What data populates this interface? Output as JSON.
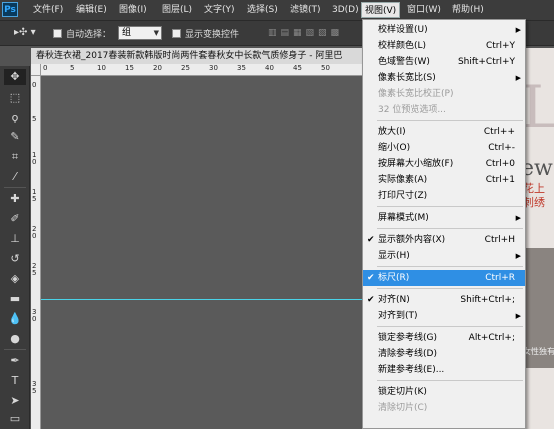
{
  "app": {
    "logo": "Ps"
  },
  "menubar": [
    "文件(F)",
    "编辑(E)",
    "图像(I)",
    "图层(L)",
    "文字(Y)",
    "选择(S)",
    "滤镜(T)",
    "3D(D)",
    "视图(V)",
    "窗口(W)",
    "帮助(H)"
  ],
  "options": {
    "auto_select_label": "自动选择：",
    "auto_select_value": "组",
    "show_transform_label": "显示变换控件"
  },
  "document": {
    "tab_title": "春秋连衣裙_2017春装新款韩版时尚两件套春秋女中长款气质修身子 - 阿里巴",
    "ruler_h": [
      "0",
      "5",
      "10",
      "15",
      "20",
      "25",
      "30",
      "35",
      "40",
      "45",
      "50"
    ],
    "ruler_v": [
      "0",
      "5",
      "1 0",
      "1 5",
      "2 0",
      "2 5",
      "3 0",
      "3 5"
    ]
  },
  "bg_image": {
    "big": "LE",
    "ew": "ew",
    "red1": "花上",
    "red2": "刺绣",
    "caption": "女性独有"
  },
  "view_menu": {
    "items": [
      {
        "label": "校样设置(U)",
        "shortcut": "",
        "submenu": true,
        "checked": false,
        "disabled": false,
        "highlighted": false
      },
      {
        "label": "校样颜色(L)",
        "shortcut": "Ctrl+Y",
        "submenu": false,
        "checked": false,
        "disabled": false,
        "highlighted": false
      },
      {
        "label": "色域警告(W)",
        "shortcut": "Shift+Ctrl+Y",
        "submenu": false,
        "checked": false,
        "disabled": false,
        "highlighted": false
      },
      {
        "label": "像素长宽比(S)",
        "shortcut": "",
        "submenu": true,
        "checked": false,
        "disabled": false,
        "highlighted": false
      },
      {
        "label": "像素长宽比校正(P)",
        "shortcut": "",
        "submenu": false,
        "checked": false,
        "disabled": true,
        "highlighted": false
      },
      {
        "label": "32 位预览选项...",
        "shortcut": "",
        "submenu": false,
        "checked": false,
        "disabled": true,
        "highlighted": false
      },
      {
        "separator": true
      },
      {
        "label": "放大(I)",
        "shortcut": "Ctrl++",
        "submenu": false,
        "checked": false,
        "disabled": false,
        "highlighted": false
      },
      {
        "label": "缩小(O)",
        "shortcut": "Ctrl+-",
        "submenu": false,
        "checked": false,
        "disabled": false,
        "highlighted": false
      },
      {
        "label": "按屏幕大小缩放(F)",
        "shortcut": "Ctrl+0",
        "submenu": false,
        "checked": false,
        "disabled": false,
        "highlighted": false
      },
      {
        "label": "实际像素(A)",
        "shortcut": "Ctrl+1",
        "submenu": false,
        "checked": false,
        "disabled": false,
        "highlighted": false
      },
      {
        "label": "打印尺寸(Z)",
        "shortcut": "",
        "submenu": false,
        "checked": false,
        "disabled": false,
        "highlighted": false
      },
      {
        "separator": true
      },
      {
        "label": "屏幕模式(M)",
        "shortcut": "",
        "submenu": true,
        "checked": false,
        "disabled": false,
        "highlighted": false
      },
      {
        "separator": true
      },
      {
        "label": "显示额外内容(X)",
        "shortcut": "Ctrl+H",
        "submenu": false,
        "checked": true,
        "disabled": false,
        "highlighted": false
      },
      {
        "label": "显示(H)",
        "shortcut": "",
        "submenu": true,
        "checked": false,
        "disabled": false,
        "highlighted": false
      },
      {
        "separator": true
      },
      {
        "label": "标尺(R)",
        "shortcut": "Ctrl+R",
        "submenu": false,
        "checked": true,
        "disabled": false,
        "highlighted": true
      },
      {
        "separator": true
      },
      {
        "label": "对齐(N)",
        "shortcut": "Shift+Ctrl+;",
        "submenu": false,
        "checked": true,
        "disabled": false,
        "highlighted": false
      },
      {
        "label": "对齐到(T)",
        "shortcut": "",
        "submenu": true,
        "checked": false,
        "disabled": false,
        "highlighted": false
      },
      {
        "separator": true
      },
      {
        "label": "锁定参考线(G)",
        "shortcut": "Alt+Ctrl+;",
        "submenu": false,
        "checked": false,
        "disabled": false,
        "highlighted": false
      },
      {
        "label": "清除参考线(D)",
        "shortcut": "",
        "submenu": false,
        "checked": false,
        "disabled": false,
        "highlighted": false
      },
      {
        "label": "新建参考线(E)...",
        "shortcut": "",
        "submenu": false,
        "checked": false,
        "disabled": false,
        "highlighted": false
      },
      {
        "separator": true
      },
      {
        "label": "锁定切片(K)",
        "shortcut": "",
        "submenu": false,
        "checked": false,
        "disabled": false,
        "highlighted": false
      },
      {
        "label": "清除切片(C)",
        "shortcut": "",
        "submenu": false,
        "checked": false,
        "disabled": true,
        "highlighted": false
      }
    ]
  },
  "tools": [
    "move-tool",
    "marquee-tool",
    "lasso-tool",
    "quick-select-tool",
    "crop-tool",
    "eyedropper-tool",
    "healing-brush-tool",
    "brush-tool",
    "clone-stamp-tool",
    "history-brush-tool",
    "eraser-tool",
    "gradient-tool",
    "blur-tool",
    "dodge-tool",
    "pen-tool",
    "type-tool",
    "path-select-tool",
    "shape-tool"
  ],
  "colors": {
    "highlight": "#2f8fe4",
    "guide": "#4ad3e8",
    "ps_blue": "#31a8ff"
  }
}
